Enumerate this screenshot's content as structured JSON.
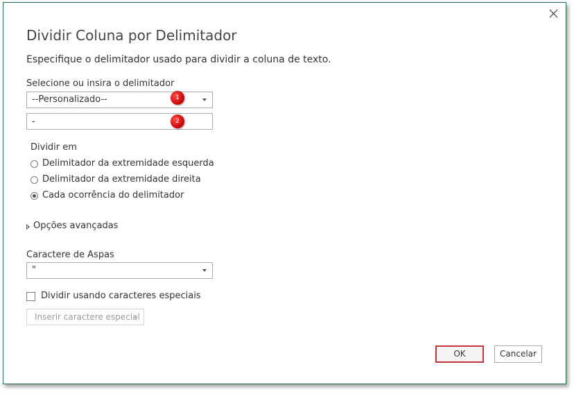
{
  "dialog": {
    "title": "Dividir Coluna por Delimitador",
    "subtitle": "Especifique o delimitador usado para dividir a coluna de texto.",
    "close_icon": "close-icon",
    "delimiter": {
      "label": "Selecione ou insira o delimitador",
      "selected": "--Personalizado--",
      "custom_value": "-",
      "marker_1": "1",
      "marker_2": "2"
    },
    "split_at": {
      "label": "Dividir em",
      "options": [
        {
          "label": "Delimitador da extremidade esquerda",
          "checked": false
        },
        {
          "label": "Delimitador da extremidade direita",
          "checked": false
        },
        {
          "label": "Cada ocorrência do delimitador",
          "checked": true
        }
      ]
    },
    "advanced": {
      "label": "Opções avançadas",
      "icon": "expand-triangle-icon"
    },
    "quote_char": {
      "label": "Caractere de Aspas",
      "selected": "\""
    },
    "special_chars": {
      "checkbox_label": "Dividir usando caracteres especiais",
      "checked": false,
      "insert_button": "Inserir caractere especial"
    },
    "buttons": {
      "ok": "OK",
      "cancel": "Cancelar"
    },
    "colors": {
      "border": "#217346",
      "ok_highlight": "#c8323a",
      "marker": "#d40000"
    }
  }
}
